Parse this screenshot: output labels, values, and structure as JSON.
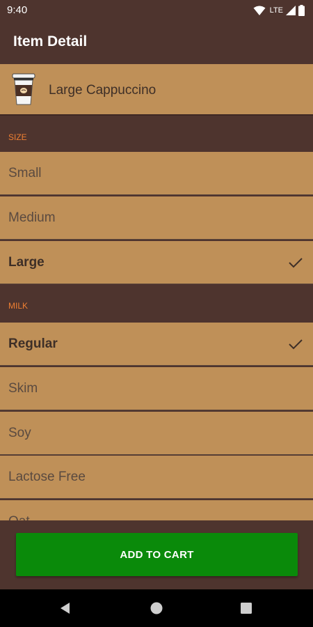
{
  "status_bar": {
    "time": "9:40",
    "network": "LTE"
  },
  "app_bar": {
    "title": "Item Detail"
  },
  "item": {
    "name": "Large Cappuccino",
    "icon": "coffee-cup-icon"
  },
  "sections": {
    "size": {
      "label": "SIZE",
      "options": [
        {
          "label": "Small",
          "selected": false
        },
        {
          "label": "Medium",
          "selected": false
        },
        {
          "label": "Large",
          "selected": true
        }
      ]
    },
    "milk": {
      "label": "MILK",
      "options": [
        {
          "label": "Regular",
          "selected": true
        },
        {
          "label": "Skim",
          "selected": false
        },
        {
          "label": "Soy",
          "selected": false
        },
        {
          "label": "Lactose Free",
          "selected": false
        },
        {
          "label": "Oat",
          "selected": false
        }
      ]
    }
  },
  "actions": {
    "add_to_cart": "ADD TO CART"
  },
  "colors": {
    "primary_dark": "#4e342e",
    "row_background": "#bf9058",
    "section_label": "#ef7f32",
    "button": "#0a8a0a"
  }
}
